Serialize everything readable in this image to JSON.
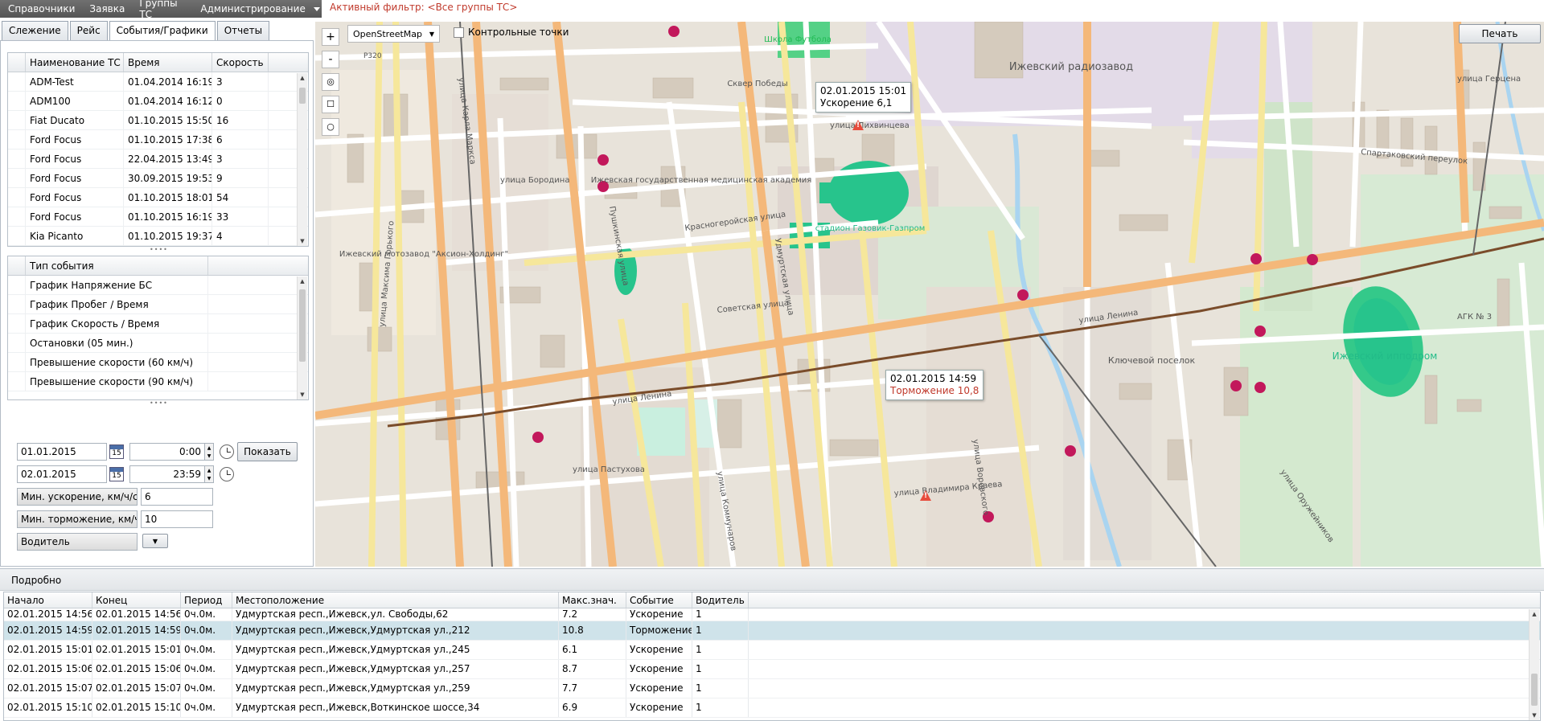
{
  "menu": {
    "items": [
      "Справочники",
      "Заявка",
      "Группы ТС",
      "Администрирование"
    ]
  },
  "active_filter": "Активный фильтр: <Все группы ТС>",
  "tabs": [
    "Слежение",
    "Рейс",
    "События/Графики",
    "Отчеты"
  ],
  "active_tab": "События/Графики",
  "vehicles": {
    "columns": [
      "Наименование ТС",
      "Время",
      "Скорость"
    ],
    "rows": [
      [
        "ADM-Test",
        "01.04.2014 16:19",
        "3"
      ],
      [
        "ADM100",
        "01.04.2014 16:12",
        "0"
      ],
      [
        "Fiat Ducato",
        "01.10.2015 15:50",
        "16"
      ],
      [
        "Ford Focus",
        "01.10.2015 17:38",
        "6"
      ],
      [
        "Ford Focus",
        "22.04.2015 13:49",
        "3"
      ],
      [
        "Ford Focus",
        "30.09.2015 19:53",
        "9"
      ],
      [
        "Ford Focus",
        "01.10.2015 18:01",
        "54"
      ],
      [
        "Ford Focus",
        "01.10.2015 16:19",
        "33"
      ],
      [
        "Kia Picanto",
        "01.10.2015 19:37",
        "4"
      ]
    ]
  },
  "event_types": {
    "column": "Тип события",
    "rows": [
      "График Напряжение БС",
      "График Пробег / Время",
      "График Скорость / Время",
      "Остановки (05 мин.)",
      "Превышение скорости (60 км/ч)",
      "Превышение скорости (90 км/ч)"
    ]
  },
  "form": {
    "date_from": "01.01.2015",
    "time_from": "0:00",
    "date_to": "02.01.2015",
    "time_to": "23:59",
    "show_button": "Показать",
    "calendar_day": "15",
    "min_accel_label": "Мин. ускорение, км/ч/с",
    "min_accel_value": "6",
    "min_brake_label": "Мин. торможение, км/ч/с",
    "min_brake_value": "10",
    "driver_label": "Водитель"
  },
  "map": {
    "layer": "OpenStreetMap",
    "checkpoints_label": "Контрольные точки",
    "print_button": "Печать",
    "zoom_in": "+",
    "zoom_out": "-",
    "tooltip_accel": {
      "time": "02.01.2015 15:01",
      "text": "Ускорение 6,1"
    },
    "tooltip_brake": {
      "time": "02.01.2015 14:59",
      "text": "Торможение 10,8"
    },
    "labels": {
      "school": "Школа Футбола",
      "radiozavod": "Ижевский радиозавод",
      "skver": "Сквер Победы",
      "academy": "Ижевская государственная медицинская академия",
      "stadium": "стадион Газовик-Газпром",
      "motozavod": "Ижевский мотозавод \"Аксион-Холдинг\"",
      "hippodrome": "Ижевский ипподром",
      "klyuchevoy": "Ключевой поселок",
      "lenina": "улица Ленина",
      "sovetskaya": "Советская улица",
      "udmurtskaya": "Удмуртская улица",
      "pushkinskaya": "Пушкинская улица",
      "kommunarov": "улица Коммунаров",
      "lihvintseva": "улица Лихвинцева",
      "borodina": "улица Бородина",
      "krasnogeroyskaya": "Красногеройская улица",
      "karla_marksa": "улица Карла Маркса",
      "maksima_gorkogo": "улица Максима Горького",
      "pastukhova": "улица Пастухова",
      "v_kraeva": "улица Владимира Краева",
      "vorovskogo": "улица Воровского",
      "r320": "P320",
      "agk": "АГК № 3",
      "sportivniy": "Спартаковский переулок",
      "gertsena": "улица Герцена",
      "oruzheynikov": "улица Оружейников"
    }
  },
  "details": {
    "title": "Подробно",
    "columns": [
      "Начало",
      "Конец",
      "Период",
      "Местоположение",
      "Макс.знач.",
      "Событие",
      "Водитель"
    ],
    "rows": [
      [
        "02.01.2015 14:56",
        "02.01.2015 14:56",
        "0ч.0м.",
        "Удмуртская респ.,Ижевск,ул. Свободы,62",
        "7.2",
        "Ускорение",
        "1"
      ],
      [
        "02.01.2015 14:59",
        "02.01.2015 14:59",
        "0ч.0м.",
        "Удмуртская респ.,Ижевск,Удмуртская ул.,212",
        "10.8",
        "Торможение",
        "1"
      ],
      [
        "02.01.2015 15:01",
        "02.01.2015 15:01",
        "0ч.0м.",
        "Удмуртская респ.,Ижевск,Удмуртская ул.,245",
        "6.1",
        "Ускорение",
        "1"
      ],
      [
        "02.01.2015 15:06",
        "02.01.2015 15:06",
        "0ч.0м.",
        "Удмуртская респ.,Ижевск,Удмуртская ул.,257",
        "8.7",
        "Ускорение",
        "1"
      ],
      [
        "02.01.2015 15:07",
        "02.01.2015 15:07",
        "0ч.0м.",
        "Удмуртская респ.,Ижевск,Удмуртская ул.,259",
        "7.7",
        "Ускорение",
        "1"
      ],
      [
        "02.01.2015 15:10",
        "02.01.2015 15:10",
        "0ч.0м.",
        "Удмуртская респ.,Ижевск,Воткинское шоссе,34",
        "6.9",
        "Ускорение",
        "1"
      ]
    ],
    "selected_row": 1
  }
}
